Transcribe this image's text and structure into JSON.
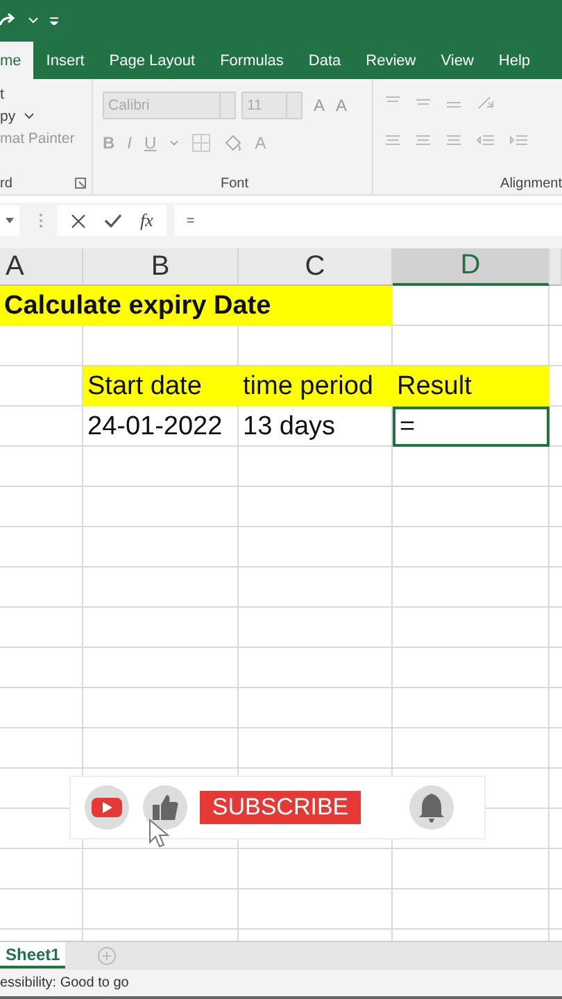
{
  "ribbon_tabs": [
    {
      "label": "me",
      "selected": true
    },
    {
      "label": "Insert",
      "selected": false
    },
    {
      "label": "Page Layout",
      "selected": false
    },
    {
      "label": "Formulas",
      "selected": false
    },
    {
      "label": "Data",
      "selected": false
    },
    {
      "label": "Review",
      "selected": false
    },
    {
      "label": "View",
      "selected": false
    },
    {
      "label": "Help",
      "selected": false
    }
  ],
  "clipboard": {
    "items": [
      "t",
      "py",
      "mat Painter"
    ],
    "label": "rd"
  },
  "font_group": {
    "font_name": "Calibri",
    "font_size": "11",
    "grow": "A",
    "shrink": "A",
    "bold": "B",
    "italic": "I",
    "underline": "U",
    "font_color": "A",
    "label": "Font"
  },
  "alignment_group": {
    "label": "Alignment"
  },
  "formula_bar": {
    "fx": "fx",
    "value": "="
  },
  "columns": [
    {
      "label": "A",
      "selected": false
    },
    {
      "label": "B",
      "selected": false
    },
    {
      "label": "C",
      "selected": false
    },
    {
      "label": "D",
      "selected": true
    }
  ],
  "rows": [
    {
      "cells": [
        {
          "kind": "title",
          "text": "Calculate expiry Date",
          "highlighted": true,
          "selected": false
        },
        {
          "kind": "empty"
        }
      ]
    },
    {
      "cells": [
        {
          "kind": "empty"
        },
        {
          "kind": "empty"
        },
        {
          "kind": "empty"
        },
        {
          "kind": "empty"
        }
      ]
    },
    {
      "cells": [
        {
          "kind": "empty"
        },
        {
          "kind": "text",
          "text": "Start date",
          "highlighted": true,
          "selected": false
        },
        {
          "kind": "text",
          "text": "time period",
          "highlighted": true,
          "selected": false
        },
        {
          "kind": "text",
          "text": "Result",
          "highlighted": true,
          "selected": false
        }
      ]
    },
    {
      "cells": [
        {
          "kind": "empty"
        },
        {
          "kind": "text",
          "text": "24-01-2022",
          "highlighted": false,
          "selected": false
        },
        {
          "kind": "text",
          "text": "13 days",
          "highlighted": false,
          "selected": false
        },
        {
          "kind": "text",
          "text": "=",
          "highlighted": false,
          "selected": true
        }
      ]
    }
  ],
  "subscribe_banner": {
    "button": "SUBSCRIBE"
  },
  "sheet_tabs": [
    {
      "label": "Sheet1",
      "selected": true
    }
  ],
  "status_bar": {
    "text": "essibility: Good to go"
  }
}
